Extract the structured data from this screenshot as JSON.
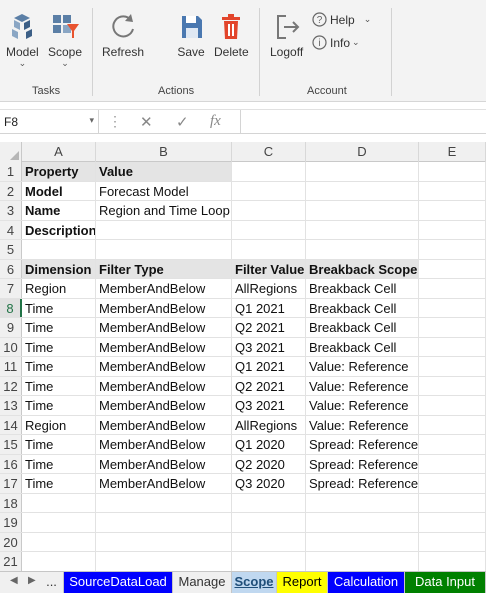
{
  "ribbon": {
    "tasks": {
      "model_label": "Model",
      "scope_label": "Scope",
      "group_label": "Tasks"
    },
    "actions": {
      "refresh_label": "Refresh",
      "save_label": "Save",
      "delete_label": "Delete",
      "group_label": "Actions"
    },
    "account": {
      "logoff_label": "Logoff",
      "help_label": "Help",
      "info_label": "Info",
      "group_label": "Account"
    }
  },
  "formula_bar": {
    "name_box": "F8",
    "fx": "fx",
    "cancel_glyph": "✕",
    "enter_glyph": "✓",
    "dots": "⋮",
    "formula": ""
  },
  "columns": [
    "A",
    "B",
    "C",
    "D",
    "E"
  ],
  "rows": [
    {
      "num": "1",
      "cells": [
        "Property",
        "Value",
        "",
        ""
      ]
    },
    {
      "num": "2",
      "cells": [
        "Model",
        "Forecast Model",
        "",
        ""
      ]
    },
    {
      "num": "3",
      "cells": [
        "Name",
        "Region and Time Loop",
        "",
        ""
      ]
    },
    {
      "num": "4",
      "cells": [
        "Description",
        "",
        "",
        ""
      ]
    },
    {
      "num": "5",
      "cells": [
        "",
        "",
        "",
        ""
      ]
    },
    {
      "num": "6",
      "cells": [
        "Dimension",
        "Filter Type",
        "Filter Value",
        "Breakback Scope"
      ]
    },
    {
      "num": "7",
      "cells": [
        "Region",
        "MemberAndBelow",
        "AllRegions",
        "Breakback Cell"
      ]
    },
    {
      "num": "8",
      "cells": [
        "Time",
        "MemberAndBelow",
        "Q1 2021",
        "Breakback Cell"
      ]
    },
    {
      "num": "9",
      "cells": [
        "Time",
        "MemberAndBelow",
        "Q2 2021",
        "Breakback Cell"
      ]
    },
    {
      "num": "10",
      "cells": [
        "Time",
        "MemberAndBelow",
        "Q3 2021",
        "Breakback Cell"
      ]
    },
    {
      "num": "11",
      "cells": [
        "Time",
        "MemberAndBelow",
        "Q1 2021",
        "Value: Reference"
      ]
    },
    {
      "num": "12",
      "cells": [
        "Time",
        "MemberAndBelow",
        "Q2 2021",
        "Value: Reference"
      ]
    },
    {
      "num": "13",
      "cells": [
        "Time",
        "MemberAndBelow",
        "Q3 2021",
        "Value: Reference"
      ]
    },
    {
      "num": "14",
      "cells": [
        "Region",
        "MemberAndBelow",
        "AllRegions",
        "Value: Reference"
      ]
    },
    {
      "num": "15",
      "cells": [
        "Time",
        "MemberAndBelow",
        "Q1 2020",
        "Spread: Reference"
      ]
    },
    {
      "num": "16",
      "cells": [
        "Time",
        "MemberAndBelow",
        "Q2 2020",
        "Spread: Reference"
      ]
    },
    {
      "num": "17",
      "cells": [
        "Time",
        "MemberAndBelow",
        "Q3 2020",
        "Spread: Reference"
      ]
    },
    {
      "num": "18",
      "cells": [
        "",
        "",
        "",
        ""
      ]
    },
    {
      "num": "19",
      "cells": [
        "",
        "",
        "",
        ""
      ]
    },
    {
      "num": "20",
      "cells": [
        "",
        "",
        "",
        ""
      ]
    },
    {
      "num": "21",
      "cells": [
        "",
        "",
        "",
        ""
      ]
    }
  ],
  "active_row": "8",
  "sheet_tabs": [
    {
      "label": "...",
      "bg": "#f0f0f0",
      "color": "#333333"
    },
    {
      "label": "SourceDataLoad",
      "bg": "#0000ff",
      "color": "#ffffff"
    },
    {
      "label": "Manage",
      "bg": "#f0f0f0",
      "color": "#333333"
    },
    {
      "label": "Scope",
      "bg": "#c0d8f0",
      "color": "#1f4e79",
      "active": true
    },
    {
      "label": "Report",
      "bg": "#ffff00",
      "color": "#000000"
    },
    {
      "label": "Calculation",
      "bg": "#0000ff",
      "color": "#ffffff"
    },
    {
      "label": "Data Input",
      "bg": "#008000",
      "color": "#ffffff"
    }
  ]
}
